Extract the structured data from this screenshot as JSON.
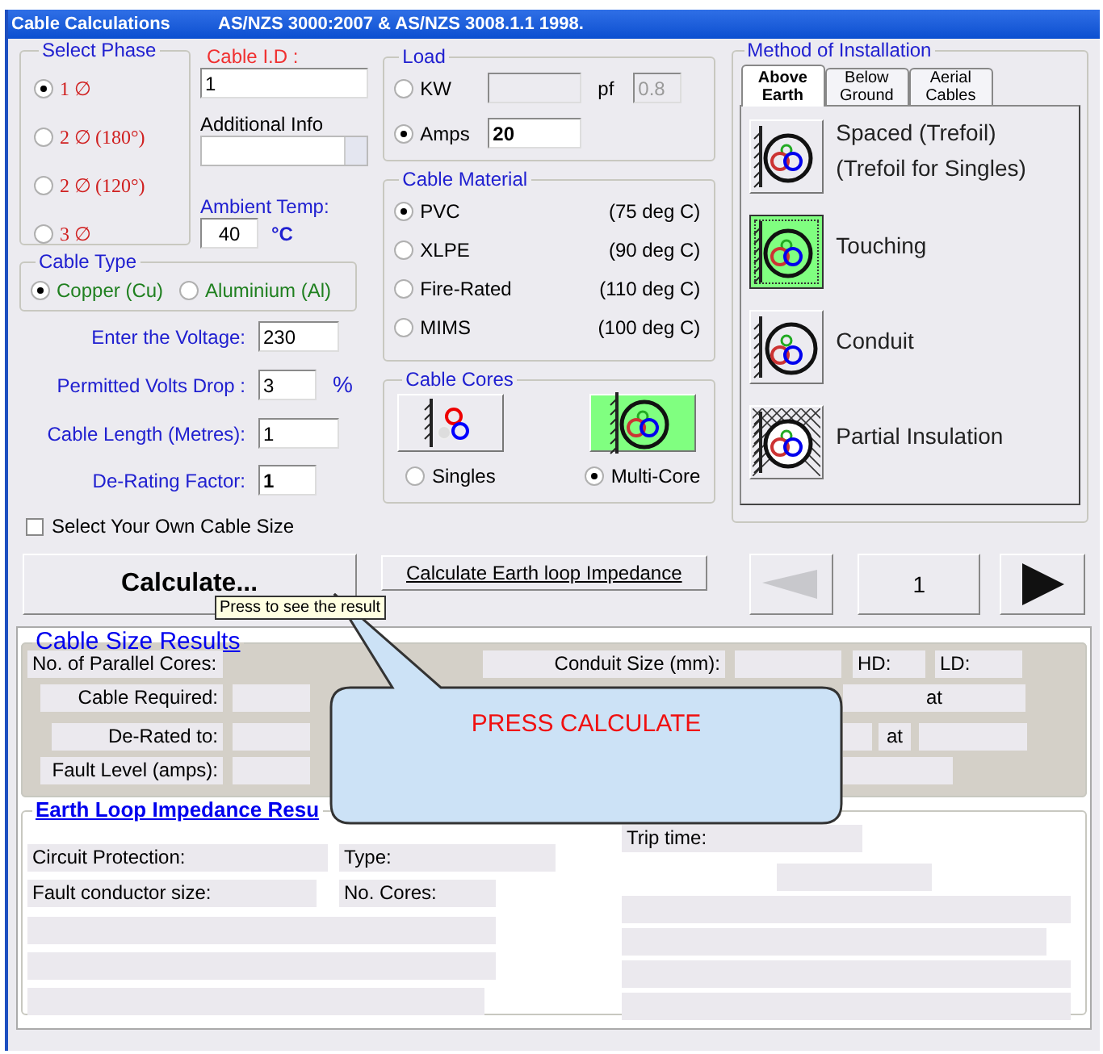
{
  "window": {
    "title": "Cable Calculations",
    "standards": "AS/NZS 3000:2007  & AS/NZS 3008.1.1 1998."
  },
  "select_phase": {
    "title": "Select Phase",
    "options": [
      {
        "label": "1 ∅",
        "selected": true
      },
      {
        "label": "2 ∅ (180°)",
        "selected": false
      },
      {
        "label": "2 ∅ (120°)",
        "selected": false
      },
      {
        "label": "3 ∅",
        "selected": false
      }
    ]
  },
  "cable_id": {
    "label": "Cable I.D :",
    "value": "1"
  },
  "additional_info": {
    "label": "Additional Info"
  },
  "ambient_temp": {
    "label": "Ambient Temp:",
    "value": "40",
    "unit": "°C"
  },
  "cable_type": {
    "title": "Cable Type",
    "options": [
      {
        "label": "Copper (Cu)",
        "selected": true
      },
      {
        "label": "Aluminium (Al)",
        "selected": false
      }
    ]
  },
  "inputs": [
    {
      "label": "Enter the Voltage:",
      "value": "230",
      "bold": false
    },
    {
      "label": "Permitted Volts Drop :",
      "value": "3",
      "unit": "%",
      "bold": false
    },
    {
      "label": "Cable Length (Metres):",
      "value": "1",
      "bold": false
    },
    {
      "label": "De-Rating Factor:",
      "value": "1",
      "bold": true
    }
  ],
  "own_size": {
    "label": "Select Your Own Cable Size",
    "checked": false
  },
  "load": {
    "title": "Load",
    "options": [
      {
        "label": "KW",
        "selected": false
      },
      {
        "label": "Amps",
        "selected": true,
        "value": "20"
      }
    ],
    "pf": {
      "label": "pf",
      "value": "0.8",
      "disabled": true
    }
  },
  "cable_material": {
    "title": "Cable Material",
    "options": [
      {
        "label": "PVC",
        "rating": "(75 deg C)",
        "selected": true
      },
      {
        "label": "XLPE",
        "rating": "(90 deg C)",
        "selected": false
      },
      {
        "label": "Fire-Rated",
        "rating": "(110 deg C)",
        "selected": false
      },
      {
        "label": "MIMS",
        "rating": "(100 deg C)",
        "selected": false
      }
    ]
  },
  "cable_cores": {
    "title": "Cable Cores",
    "options": [
      {
        "kind": "singles",
        "label": "Singles",
        "selected": false
      },
      {
        "kind": "multi",
        "label": "Multi-Core",
        "selected": true
      }
    ]
  },
  "installation": {
    "title": "Method of Installation",
    "tabs": [
      {
        "label": "Above Earth",
        "selected": true
      },
      {
        "label": "Below Ground",
        "selected": false
      },
      {
        "label": "Aerial Cables",
        "selected": false
      }
    ],
    "methods": [
      {
        "kind": "spaced",
        "label": "Spaced (Trefoil)",
        "note": "(Trefoil for Singles)",
        "selected": false
      },
      {
        "kind": "touching",
        "label": "Touching",
        "selected": true
      },
      {
        "kind": "conduit",
        "label": "Conduit",
        "selected": false
      },
      {
        "kind": "partial",
        "label": "Partial Insulation",
        "selected": false
      }
    ]
  },
  "actions": {
    "calculate": "Calculate...",
    "tooltip": "Press to see the result",
    "earth_loop": "Calculate Earth loop Impedance",
    "prev_disabled": true,
    "next_disabled": false,
    "page": "1"
  },
  "cable_size_results": {
    "title": "Cable Size Results",
    "parallel_cores": "No. of Parallel Cores:",
    "conduit_size": "Conduit Size (mm):",
    "hd": "HD:",
    "ld": "LD:",
    "cable_required": "Cable Required:",
    "at_1": "at",
    "derated_to": "De-Rated to:",
    "at_2": "at",
    "fault_level": "Fault Level (amps):"
  },
  "earth_loop_results": {
    "title": "Earth Loop Impedance Resu",
    "circuit_protection": "Circuit Protection:",
    "type": "Type:",
    "fault_conductor": "Fault conductor size:",
    "no_cores": "No. Cores:",
    "trip_time": "Trip time:"
  },
  "balloon": {
    "text": "PRESS CALCULATE"
  }
}
